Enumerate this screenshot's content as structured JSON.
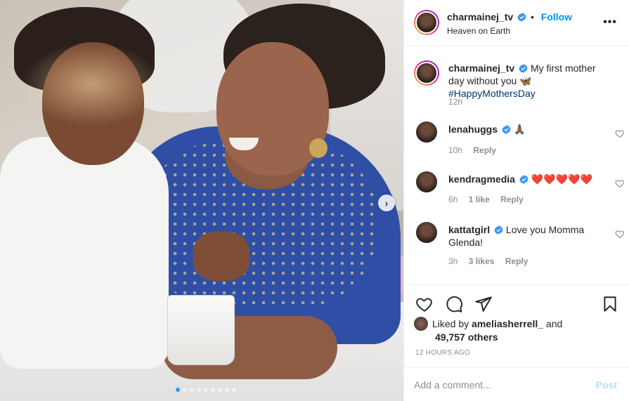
{
  "post": {
    "author": "charmainej_tv",
    "follow_label": "Follow",
    "separator": "•",
    "location": "Heaven on Earth",
    "more_icon": "more-horizontal-icon",
    "photo_description_icon": "photo",
    "carousel": {
      "total_slides": 9,
      "active_slide": 1
    }
  },
  "caption": {
    "author": "charmainej_tv",
    "text": "My first mother day without you",
    "emoji": "🦋",
    "hashtag": "#HappyMothersDay",
    "time": "12h"
  },
  "comments": [
    {
      "author": "lenahuggs",
      "text": "🙏🏾",
      "time": "10h",
      "likes": "",
      "reply_label": "Reply"
    },
    {
      "author": "kendragmedia",
      "text": "❤️❤️❤️❤️❤️",
      "time": "6h",
      "likes": "1 like",
      "reply_label": "Reply"
    },
    {
      "author": "kattatgirl",
      "text": "Love you Momma Glenda!",
      "time": "3h",
      "likes": "3 likes",
      "reply_label": "Reply"
    }
  ],
  "likes": {
    "liked_by_prefix": "Liked by",
    "liked_by_user": "ameliasherrell_",
    "and": "and",
    "others": "49,757 others"
  },
  "timestamp": "12 HOURS AGO",
  "add_comment": {
    "placeholder": "Add a comment...",
    "post_label": "Post"
  },
  "colors": {
    "link_blue": "#0095f6",
    "hashtag": "#00376b",
    "muted": "#8e8e8e",
    "post_disabled": "#b2dffc"
  }
}
